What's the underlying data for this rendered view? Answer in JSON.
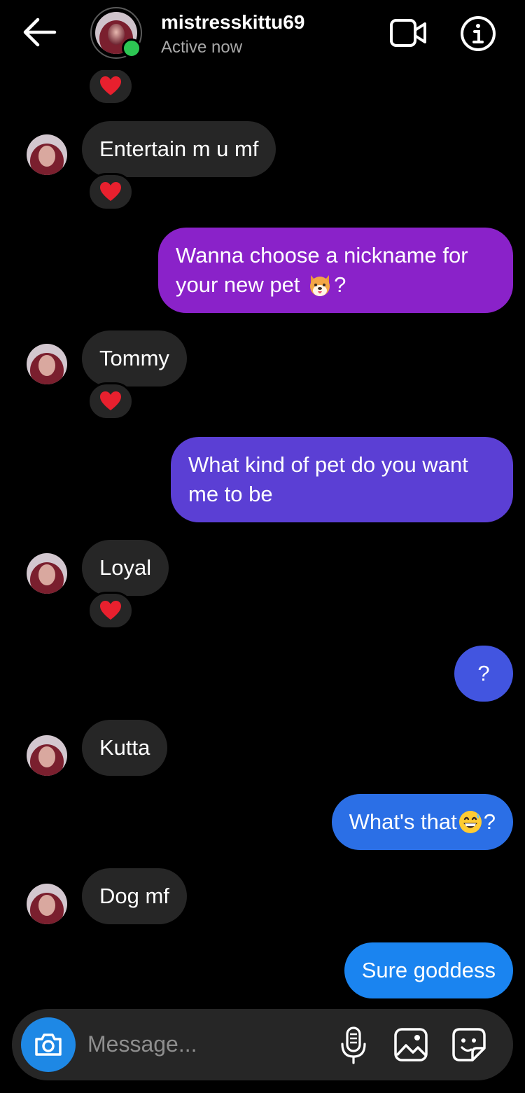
{
  "header": {
    "username": "mistresskittu69",
    "status": "Active now",
    "colors": {
      "online": "#2dc653",
      "muted": "#a8a8a8"
    }
  },
  "messages": [
    {
      "side": "in",
      "text": "Entertain m u mf",
      "reaction": "heart"
    },
    {
      "side": "out",
      "text_line1": "Wanna choose a nickname for",
      "text_line2_prefix": "your new pet ",
      "emoji": "dog-face-emoji",
      "text_line2_suffix": "?",
      "color": "#8a22c9"
    },
    {
      "side": "in",
      "text": "Tommy",
      "reaction": "heart"
    },
    {
      "side": "out",
      "text_line1": "What kind of pet do you want",
      "text_line2": "me to be",
      "color": "#5b3fd4"
    },
    {
      "side": "in",
      "text": "Loyal",
      "reaction": "heart"
    },
    {
      "side": "out",
      "text": "?",
      "color": "#4255e0"
    },
    {
      "side": "in",
      "text": "Kutta"
    },
    {
      "side": "out",
      "text_prefix": "What's that",
      "emoji": "grinning-sweat-emoji",
      "text_suffix": "?",
      "color": "#2b6fe6"
    },
    {
      "side": "in",
      "text": "Dog mf"
    },
    {
      "side": "out",
      "text": "Sure goddess",
      "color": "#1a84f0"
    }
  ],
  "composer": {
    "placeholder": "Message...",
    "icons": [
      "camera-icon",
      "microphone-icon",
      "gallery-icon",
      "sticker-icon"
    ],
    "camera_color": "#1e88e5"
  }
}
